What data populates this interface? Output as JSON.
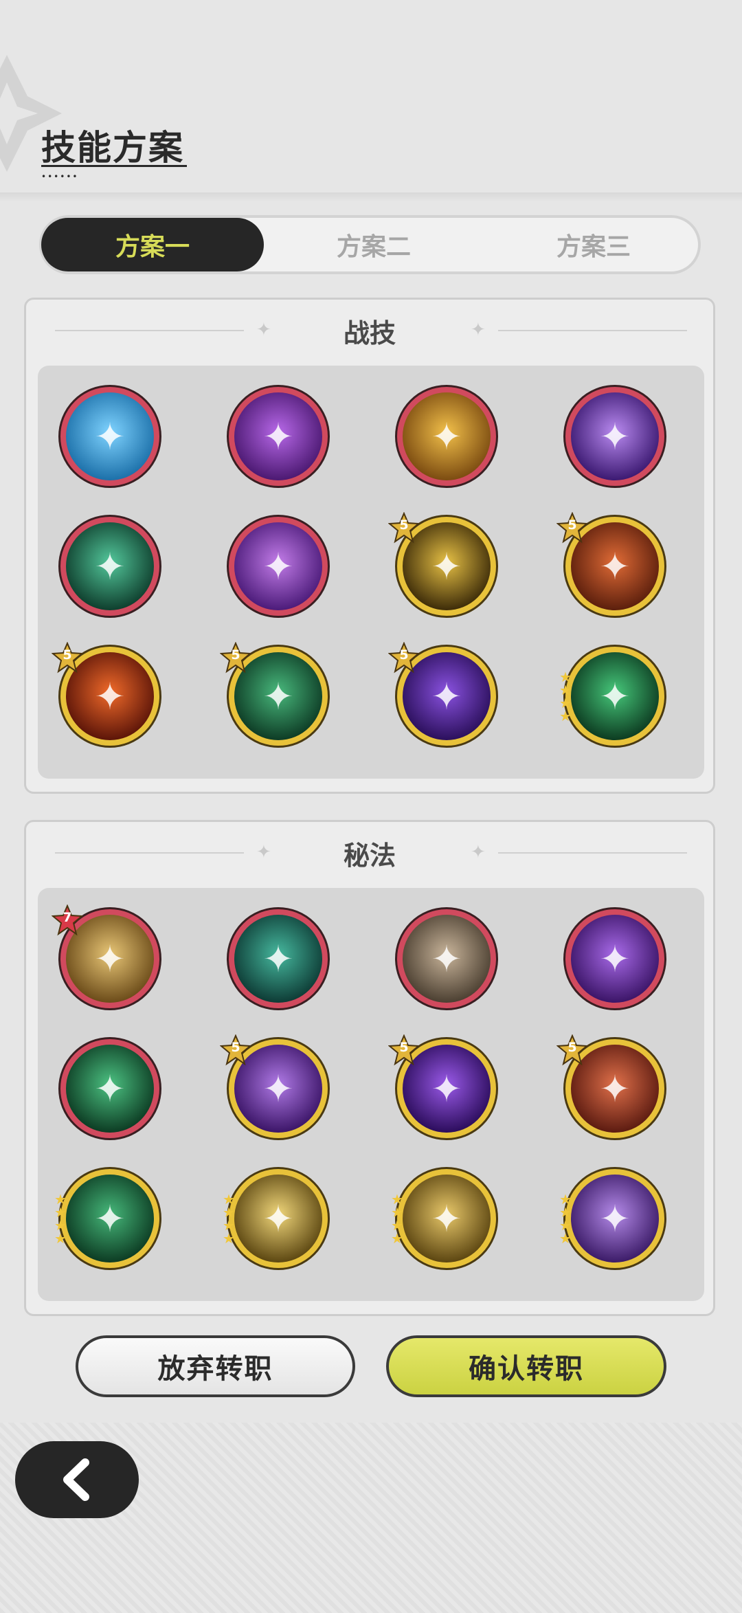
{
  "header": {
    "title": "技能方案"
  },
  "tabs": [
    {
      "label": "方案一",
      "active": true
    },
    {
      "label": "方案二",
      "active": false
    },
    {
      "label": "方案三",
      "active": false
    }
  ],
  "combat_section": {
    "title": "战技",
    "skills": [
      {
        "name": "ice-burst-icon",
        "frame": "red",
        "colors": [
          "#1b6fa8",
          "#7fd3ff"
        ]
      },
      {
        "name": "violet-star-icon",
        "frame": "red",
        "colors": [
          "#4a1870",
          "#b768e8"
        ]
      },
      {
        "name": "golden-golem-icon",
        "frame": "red",
        "colors": [
          "#7a4a10",
          "#f2c04a"
        ]
      },
      {
        "name": "purple-pillar-icon",
        "frame": "red",
        "colors": [
          "#3a1870",
          "#b98af0"
        ]
      },
      {
        "name": "green-spirit-icon",
        "frame": "red",
        "colors": [
          "#0e3d2c",
          "#53c79b"
        ]
      },
      {
        "name": "violet-crest-icon",
        "frame": "red",
        "colors": [
          "#4a1a78",
          "#c27ce8"
        ]
      },
      {
        "name": "gold-crystal-icon",
        "frame": "gold",
        "colors": [
          "#3b2a08",
          "#e6c045"
        ],
        "badge": "5"
      },
      {
        "name": "fire-shield-icon",
        "frame": "gold",
        "colors": [
          "#5a1e0c",
          "#e06b36"
        ],
        "badge": "5"
      },
      {
        "name": "fireball-icon",
        "frame": "gold",
        "colors": [
          "#5a1408",
          "#f06a2a"
        ],
        "badge": "5"
      },
      {
        "name": "thorn-vine-icon",
        "frame": "gold",
        "colors": [
          "#0d3a24",
          "#48b87c"
        ],
        "badge": "5"
      },
      {
        "name": "arcane-shield-icon",
        "frame": "gold",
        "colors": [
          "#2a0f5a",
          "#8a52e0"
        ],
        "badge": "5"
      },
      {
        "name": "green-comet-icon",
        "frame": "gold",
        "colors": [
          "#0c3a20",
          "#46c77a"
        ],
        "stars": 4
      }
    ]
  },
  "secret_section": {
    "title": "秘法",
    "skills": [
      {
        "name": "prayer-figure-icon",
        "frame": "red",
        "colors": [
          "#6a4a18",
          "#e8c676"
        ],
        "badge": "7",
        "badge_color": "#d83a48"
      },
      {
        "name": "healing-figure-icon",
        "frame": "red",
        "colors": [
          "#0d3a34",
          "#46b89e"
        ]
      },
      {
        "name": "stone-figure-icon",
        "frame": "red",
        "colors": [
          "#4a3e30",
          "#c8b49a"
        ]
      },
      {
        "name": "purple-strike-icon",
        "frame": "red",
        "colors": [
          "#3a1466",
          "#a86ae8"
        ]
      },
      {
        "name": "green-totem-icon",
        "frame": "red",
        "colors": [
          "#0c3a22",
          "#4cc282"
        ]
      },
      {
        "name": "mystic-eye-icon",
        "frame": "gold",
        "colors": [
          "#3a1466",
          "#b07ae6"
        ],
        "badge": "5"
      },
      {
        "name": "void-orb-icon",
        "frame": "gold",
        "colors": [
          "#2a0c5a",
          "#9a5ae8"
        ],
        "badge": "5"
      },
      {
        "name": "fist-crash-icon",
        "frame": "gold",
        "colors": [
          "#5a1a10",
          "#e0704a"
        ],
        "badge": "5"
      },
      {
        "name": "green-wings-icon",
        "frame": "gold",
        "colors": [
          "#0c3a22",
          "#46b87a"
        ],
        "stars": 4
      },
      {
        "name": "golden-spark-icon",
        "frame": "gold",
        "colors": [
          "#5a4510",
          "#f0d67a"
        ],
        "stars": 4
      },
      {
        "name": "golden-dash-icon",
        "frame": "gold",
        "colors": [
          "#5a4410",
          "#e8c86a"
        ],
        "stars": 4
      },
      {
        "name": "arcane-hand-icon",
        "frame": "gold",
        "colors": [
          "#3a1a66",
          "#b48ae8"
        ],
        "stars": 4
      }
    ]
  },
  "actions": {
    "abandon_label": "放弃转职",
    "confirm_label": "确认转职"
  },
  "icons": {
    "back": "chevron-left-icon"
  },
  "colors": {
    "accent": "#d7dc58",
    "dark": "#262626",
    "confirm_bg": "#cbd242"
  }
}
